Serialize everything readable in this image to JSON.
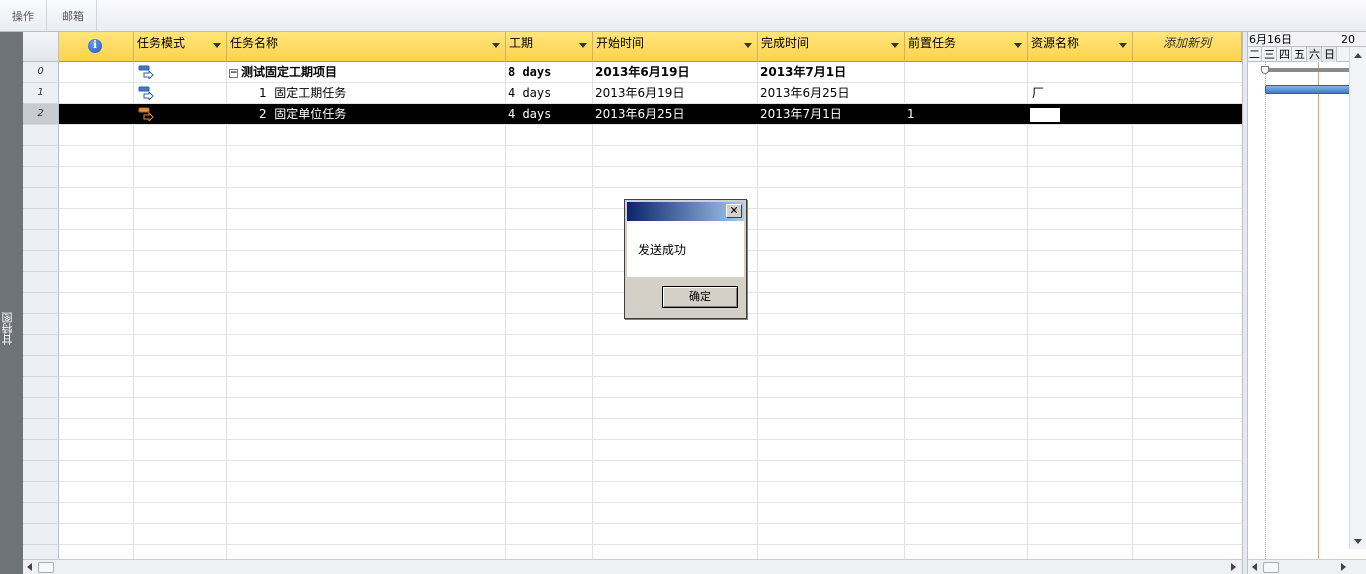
{
  "menubar": {
    "items": [
      "操作",
      "邮箱"
    ]
  },
  "viewbar": {
    "label": "甘特图"
  },
  "columns": [
    {
      "key": "info",
      "label": ""
    },
    {
      "key": "mode",
      "label": "任务模式"
    },
    {
      "key": "name",
      "label": "任务名称"
    },
    {
      "key": "duration",
      "label": "工期"
    },
    {
      "key": "start",
      "label": "开始时间"
    },
    {
      "key": "finish",
      "label": "完成时间"
    },
    {
      "key": "predecessors",
      "label": "前置任务"
    },
    {
      "key": "resources",
      "label": "资源名称"
    },
    {
      "key": "add",
      "label": "添加新列"
    }
  ],
  "rows": [
    {
      "id": "0",
      "name": "测试固定工期项目",
      "duration": "8 days",
      "start": "2013年6月19日",
      "finish": "2013年7月1日",
      "predecessors": "",
      "resources": "",
      "summary": true,
      "selected": false
    },
    {
      "id": "1",
      "wbs": "1",
      "name": "固定工期任务",
      "duration": "4 days",
      "start": "2013年6月19日",
      "finish": "2013年6月25日",
      "predecessors": "",
      "resources": "厂",
      "summary": false,
      "selected": false
    },
    {
      "id": "2",
      "wbs": "2",
      "name": "固定单位任务",
      "duration": "4 days",
      "start": "2013年6月25日",
      "finish": "2013年7月1日",
      "predecessors": "1",
      "resources": "",
      "summary": false,
      "selected": true
    }
  ],
  "gantt": {
    "week_label": "6月16日",
    "next_week_label": "20",
    "days": [
      "二",
      "三",
      "四",
      "五",
      "六",
      "日"
    ]
  },
  "dialog": {
    "message": "发送成功",
    "ok_label": "确定",
    "close_glyph": "✕"
  },
  "colors": {
    "header_yellow": "#ffd24d",
    "selected_row": "#000000",
    "task_bar": "#3f79c7",
    "today_line": "#e8a060"
  }
}
